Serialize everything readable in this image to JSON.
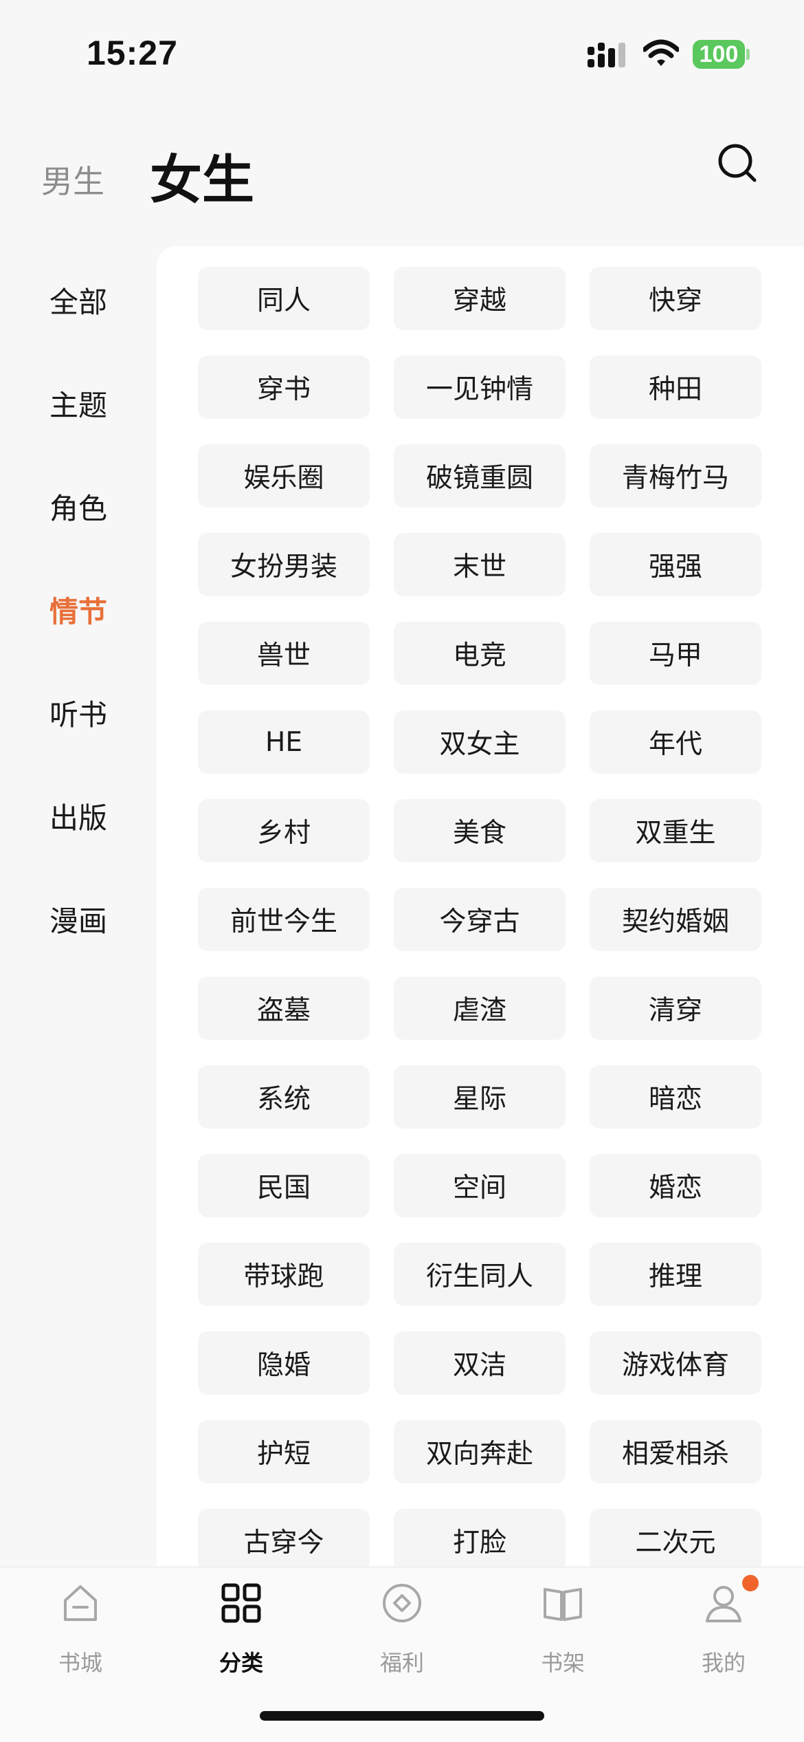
{
  "status_bar": {
    "time": "15:27",
    "battery": "100"
  },
  "header": {
    "male_tab": "男生",
    "female_tab": "女生",
    "search_icon": "search-icon"
  },
  "sidebar": {
    "items": [
      {
        "label": "全部",
        "active": false
      },
      {
        "label": "主题",
        "active": false
      },
      {
        "label": "角色",
        "active": false
      },
      {
        "label": "情节",
        "active": true
      },
      {
        "label": "听书",
        "active": false
      },
      {
        "label": "出版",
        "active": false
      },
      {
        "label": "漫画",
        "active": false
      }
    ]
  },
  "tags": [
    "同人",
    "穿越",
    "快穿",
    "穿书",
    "一见钟情",
    "种田",
    "娱乐圈",
    "破镜重圆",
    "青梅竹马",
    "女扮男装",
    "末世",
    "强强",
    "兽世",
    "电竞",
    "马甲",
    "HE",
    "双女主",
    "年代",
    "乡村",
    "美食",
    "双重生",
    "前世今生",
    "今穿古",
    "契约婚姻",
    "盗墓",
    "虐渣",
    "清穿",
    "系统",
    "星际",
    "暗恋",
    "民国",
    "空间",
    "婚恋",
    "带球跑",
    "衍生同人",
    "推理",
    "隐婚",
    "双洁",
    "游戏体育",
    "护短",
    "双向奔赴",
    "相爱相杀",
    "古穿今",
    "打脸",
    "二次元"
  ],
  "tabbar": {
    "items": [
      {
        "label": "书城",
        "icon": "home-icon",
        "active": false
      },
      {
        "label": "分类",
        "icon": "category-grid-icon",
        "active": true
      },
      {
        "label": "福利",
        "icon": "gift-coin-icon",
        "active": false
      },
      {
        "label": "书架",
        "icon": "book-open-icon",
        "active": false
      },
      {
        "label": "我的",
        "icon": "user-icon",
        "active": false
      }
    ]
  },
  "colors": {
    "accent": "#e8703a",
    "badge": "#f0642c",
    "battery": "#5ac85c"
  }
}
